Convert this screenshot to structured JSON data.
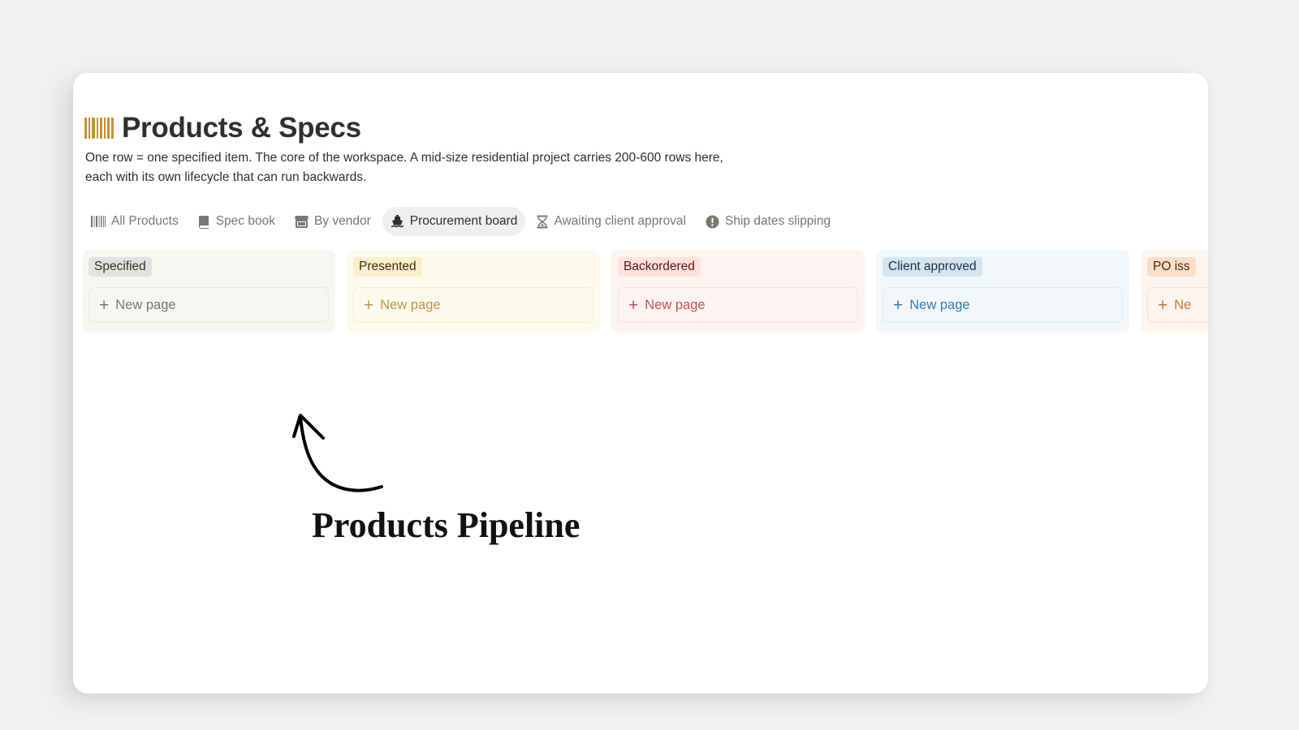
{
  "page": {
    "icon": "barcode-icon",
    "icon_color": "#c4923a",
    "title": "Products & Specs",
    "description_line1": "One row = one specified item. The core of the workspace. A mid-size residential project carries 200-600 rows here,",
    "description_line2": "each with its own lifecycle that can run backwards."
  },
  "tabs": [
    {
      "label": "All Products",
      "icon": "barcode-icon",
      "active": false
    },
    {
      "label": "Spec book",
      "icon": "book-icon",
      "active": false
    },
    {
      "label": "By vendor",
      "icon": "storefront-icon",
      "active": false
    },
    {
      "label": "Procurement board",
      "icon": "ship-icon",
      "active": true
    },
    {
      "label": "Awaiting client approval",
      "icon": "hourglass-icon",
      "active": false
    },
    {
      "label": "Ship dates slipping",
      "icon": "alert-icon",
      "active": false
    }
  ],
  "columns": [
    {
      "status": "Specified",
      "new_page_label": "New page",
      "pill_bg": "#e3e2e0",
      "pill_text": "#32302c",
      "col_bg": "#f7f6f3",
      "card_text": "#787774",
      "card_border": "#e9e9e7"
    },
    {
      "status": "Presented",
      "new_page_label": "New page",
      "pill_bg": "#fbeecb",
      "pill_text": "#402c1b",
      "col_bg": "#fdfaee",
      "card_text": "#c29343",
      "card_border": "#f4ecd3"
    },
    {
      "status": "Backordered",
      "new_page_label": "New page",
      "pill_bg": "#ffe2dd",
      "pill_text": "#5d1715",
      "col_bg": "#fdf4f2",
      "card_text": "#c4554d",
      "card_border": "#f6e2de"
    },
    {
      "status": "Client approved",
      "new_page_label": "New page",
      "pill_bg": "#d3e5ef",
      "pill_text": "#183347",
      "col_bg": "#f3f7fb",
      "card_text": "#2f7eb4",
      "card_border": "#e1ebf3"
    },
    {
      "status": "PO iss",
      "new_page_label": "Ne",
      "pill_bg": "#fadec9",
      "pill_text": "#49290e",
      "col_bg": "#fcf5f0",
      "card_text": "#cc782f",
      "card_border": "#f4e3d6"
    }
  ],
  "annotation": {
    "label": "Products Pipeline"
  }
}
